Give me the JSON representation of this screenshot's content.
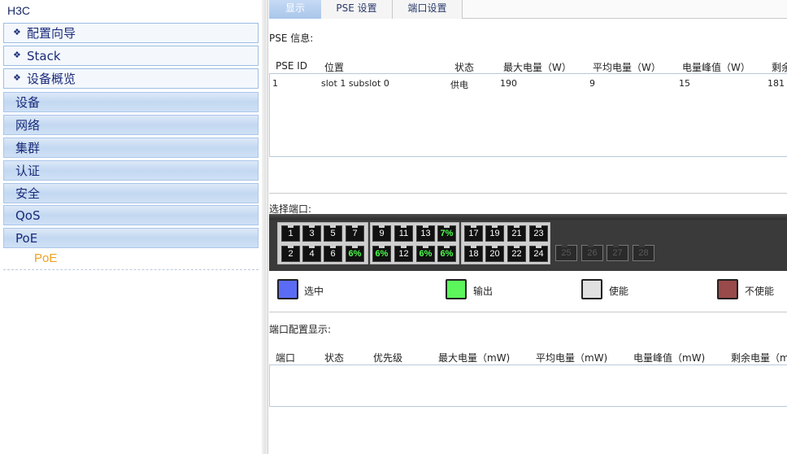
{
  "sidebar": {
    "brand": "H3C",
    "groups": [
      {
        "label": "配置向导"
      },
      {
        "label": "Stack"
      },
      {
        "label": "设备概览"
      }
    ],
    "categories": [
      {
        "label": "设备"
      },
      {
        "label": "网络"
      },
      {
        "label": "集群"
      },
      {
        "label": "认证"
      },
      {
        "label": "安全"
      },
      {
        "label": "QoS"
      },
      {
        "label": "PoE"
      }
    ],
    "sub_item": "PoE"
  },
  "tabs": [
    {
      "label": "显示"
    },
    {
      "label": "PSE 设置"
    },
    {
      "label": "端口设置"
    }
  ],
  "pse": {
    "section_label": "PSE 信息:",
    "headers": [
      "PSE ID",
      "位置",
      "状态",
      "最大电量（W）",
      "平均电量（W）",
      "电量峰值（W）",
      "剩余"
    ],
    "rows": [
      [
        "1",
        "slot 1 subslot 0",
        "供电",
        "190",
        "9",
        "15",
        "181"
      ]
    ]
  },
  "port_select": {
    "section_label": "选择端口:",
    "bank1_top": [
      "1",
      "3",
      "5",
      "7"
    ],
    "bank1_bottom": [
      "2",
      "4",
      "6",
      "6%"
    ],
    "bank2_top": [
      "9",
      "11",
      "13",
      "7%"
    ],
    "bank2_bottom": [
      "6%",
      "12",
      "6%",
      "6%"
    ],
    "bank3_top": [
      "17",
      "19",
      "21",
      "23"
    ],
    "bank3_bottom": [
      "18",
      "20",
      "22",
      "24"
    ],
    "uplinks": [
      "25",
      "26",
      "27",
      "28"
    ]
  },
  "legend": [
    {
      "label": "选中",
      "color": "#5a6cf5"
    },
    {
      "label": "输出",
      "color": "#5cf55c"
    },
    {
      "label": "使能",
      "color": "#e0e0e0"
    },
    {
      "label": "不使能",
      "color": "#9a4a4a"
    }
  ],
  "port_config": {
    "section_label": "端口配置显示:",
    "headers": [
      "端口",
      "状态",
      "优先级",
      "最大电量（mW)",
      "平均电量（mW)",
      "电量峰值（mW)",
      "剩余电量（m"
    ]
  }
}
